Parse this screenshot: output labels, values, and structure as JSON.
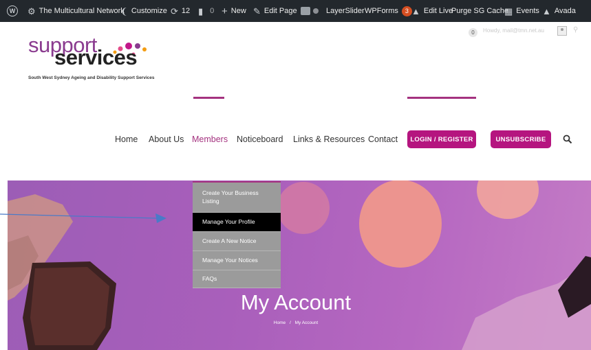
{
  "admin_bar": {
    "site_name": "The Multicultural Network",
    "customize": "Customize",
    "updates_count": "12",
    "comments_count": "0",
    "new": "New",
    "edit_page": "Edit Page",
    "layerslider": "LayerSlider",
    "wpforms": "WPForms",
    "wpforms_badge": "3",
    "edit_live": "Edit Live",
    "purge_cache": "Purge SG Cache",
    "events": "Events",
    "avada": "Avada"
  },
  "logo": {
    "word1": "support",
    "word2": "services",
    "tagline": "South West Sydney Ageing and Disability Support Services"
  },
  "user_area": {
    "notification_count": "0",
    "howdy": "Howdy, mail@tmn.net.au"
  },
  "nav": {
    "items": [
      "Home",
      "About Us",
      "Members",
      "Noticeboard",
      "Links & Resources",
      "Contact"
    ],
    "login_button": "LOGIN / REGISTER",
    "unsubscribe_button": "UNSUBSCRIBE"
  },
  "dropdown": {
    "items": [
      "Create Your Business Listing",
      "Manage Your Profile",
      "Create A New Notice",
      "Manage Your Notices",
      "FAQs"
    ],
    "selected_index": 1
  },
  "hero": {
    "title": "My Account",
    "breadcrumb_home": "Home",
    "breadcrumb_sep": "/",
    "breadcrumb_current": "My Account"
  },
  "colors": {
    "brand_magenta": "#b5157f",
    "accent_purple": "#a4327f",
    "admin_bar": "#23282d",
    "hero_purple": "#a95fbb",
    "annotation_arrow": "#4a7ac8"
  },
  "icons": {
    "wordpress": "wordpress-logo-icon",
    "site": "dashboard-icon",
    "customize": "paintbrush-icon",
    "updates": "refresh-icon",
    "comments": "comment-icon",
    "new": "plus-icon",
    "edit": "pencil-icon",
    "yoast": "yoast-icon",
    "avada": "avada-icon",
    "events": "calendar-icon",
    "search": "search-icon"
  }
}
